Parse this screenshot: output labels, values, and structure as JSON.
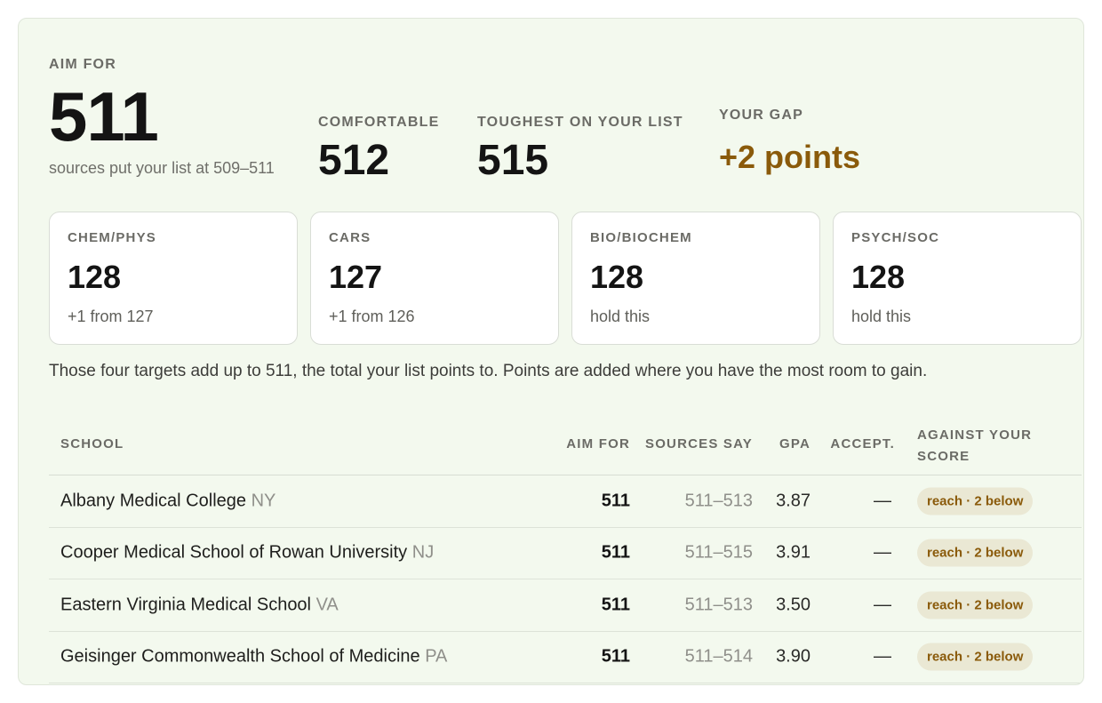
{
  "summary": {
    "aim_label": "AIM FOR",
    "aim_value": "511",
    "aim_sub": "sources put your list at 509–511",
    "comfortable_label": "COMFORTABLE",
    "comfortable_value": "512",
    "toughest_label": "TOUGHEST ON YOUR LIST",
    "toughest_value": "515",
    "gap_label": "YOUR GAP",
    "gap_value": "+2 points"
  },
  "sections": [
    {
      "label": "CHEM/PHYS",
      "value": "128",
      "note": "+1 from 127"
    },
    {
      "label": "CARS",
      "value": "127",
      "note": "+1 from 126"
    },
    {
      "label": "BIO/BIOCHEM",
      "value": "128",
      "note": "hold this"
    },
    {
      "label": "PSYCH/SOC",
      "value": "128",
      "note": "hold this"
    }
  ],
  "explanation": "Those four targets add up to 511, the total your list points to. Points are added where you have the most room to gain.",
  "table": {
    "headers": {
      "school": "SCHOOL",
      "aim": "AIM FOR",
      "sources": "SOURCES SAY",
      "gpa": "GPA",
      "accept": "ACCEPT.",
      "against_line1": "AGAINST YOUR",
      "against_line2": "SCORE"
    },
    "rows": [
      {
        "school": "Albany Medical College",
        "state": "NY",
        "aim": "511",
        "sources": "511–513",
        "gpa": "3.87",
        "accept": "—",
        "badge": "reach · 2 below"
      },
      {
        "school": "Cooper Medical School of Rowan University",
        "state": "NJ",
        "aim": "511",
        "sources": "511–515",
        "gpa": "3.91",
        "accept": "—",
        "badge": "reach · 2 below"
      },
      {
        "school": "Eastern Virginia Medical School",
        "state": "VA",
        "aim": "511",
        "sources": "511–513",
        "gpa": "3.50",
        "accept": "—",
        "badge": "reach · 2 below"
      },
      {
        "school": "Geisinger Commonwealth School of Medicine",
        "state": "PA",
        "aim": "511",
        "sources": "511–514",
        "gpa": "3.90",
        "accept": "—",
        "badge": "reach · 2 below"
      }
    ]
  },
  "colors": {
    "panel_bg": "#f3f9ee",
    "gap_accent": "#8a5a0a",
    "badge_bg": "#eae8d4"
  }
}
